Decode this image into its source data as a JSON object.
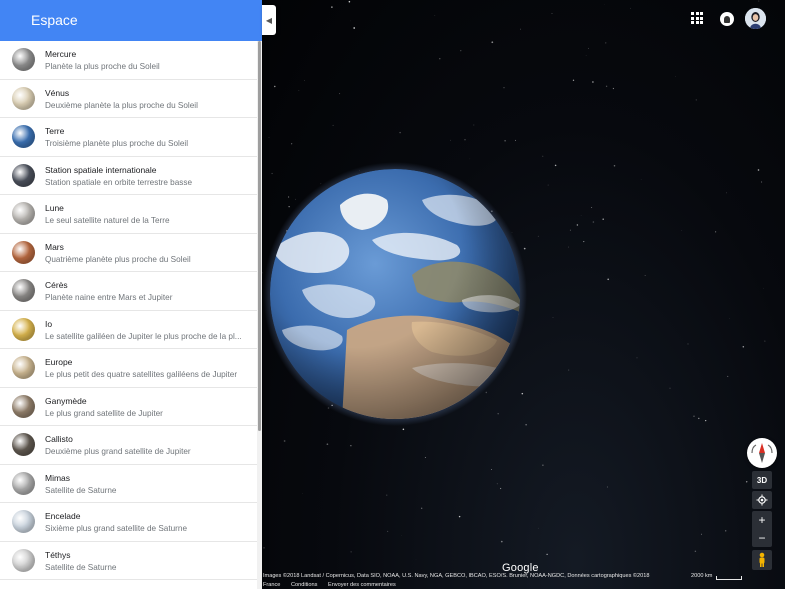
{
  "sidebar": {
    "title": "Espace",
    "items": [
      {
        "name": "Mercure",
        "desc": "Planète la plus proche du Soleil",
        "color": "#8d8d8d"
      },
      {
        "name": "Vénus",
        "desc": "Deuxième planète la plus proche du Soleil",
        "color": "#d9cdb2"
      },
      {
        "name": "Terre",
        "desc": "Troisième planète plus proche du Soleil",
        "color": "#3a6fb0"
      },
      {
        "name": "Station spatiale internationale",
        "desc": "Station spatiale en orbite terrestre basse",
        "color": "#4a4f5a"
      },
      {
        "name": "Lune",
        "desc": "Le seul satellite naturel de la Terre",
        "color": "#b7b4b0"
      },
      {
        "name": "Mars",
        "desc": "Quatrième planète plus proche du Soleil",
        "color": "#b5673f"
      },
      {
        "name": "Cérès",
        "desc": "Planète naine entre Mars et Jupiter",
        "color": "#8a8886"
      },
      {
        "name": "Io",
        "desc": "Le satellite galiléen de Jupiter le plus proche de la pl...",
        "color": "#d6b24c"
      },
      {
        "name": "Europe",
        "desc": "Le plus petit des quatre satellites galiléens de Jupiter",
        "color": "#c9b48f"
      },
      {
        "name": "Ganymède",
        "desc": "Le plus grand satellite de Jupiter",
        "color": "#8f7d69"
      },
      {
        "name": "Callisto",
        "desc": "Deuxième plus grand satellite de Jupiter",
        "color": "#5e574f"
      },
      {
        "name": "Mimas",
        "desc": "Satellite de Saturne",
        "color": "#a9a9a9"
      },
      {
        "name": "Encelade",
        "desc": "Sixième plus grand satellite de Saturne",
        "color": "#c8d2dc"
      },
      {
        "name": "Téthys",
        "desc": "Satellite de Saturne",
        "color": "#cfcfcf"
      }
    ]
  },
  "map": {
    "compass_label": "N",
    "three_d_label": "3D",
    "zoom_in": "+",
    "zoom_out": "−",
    "logo": "Google",
    "attribution": "Images ©2018 Landsat / Copernicus, Data SIO, NOAA, U.S. Navy, NGA, GEBCO, IBCAO, ESO/S. Brunier, NOAA-NGDC, Données cartographiques ©2018",
    "scale": "2000 km",
    "footer_links": [
      "France",
      "Conditions",
      "Envoyer des commentaires"
    ]
  },
  "colors": {
    "header": "#4285f4",
    "ocean": "#3f73b8",
    "land": "#c9a784",
    "space": "#05070c"
  }
}
